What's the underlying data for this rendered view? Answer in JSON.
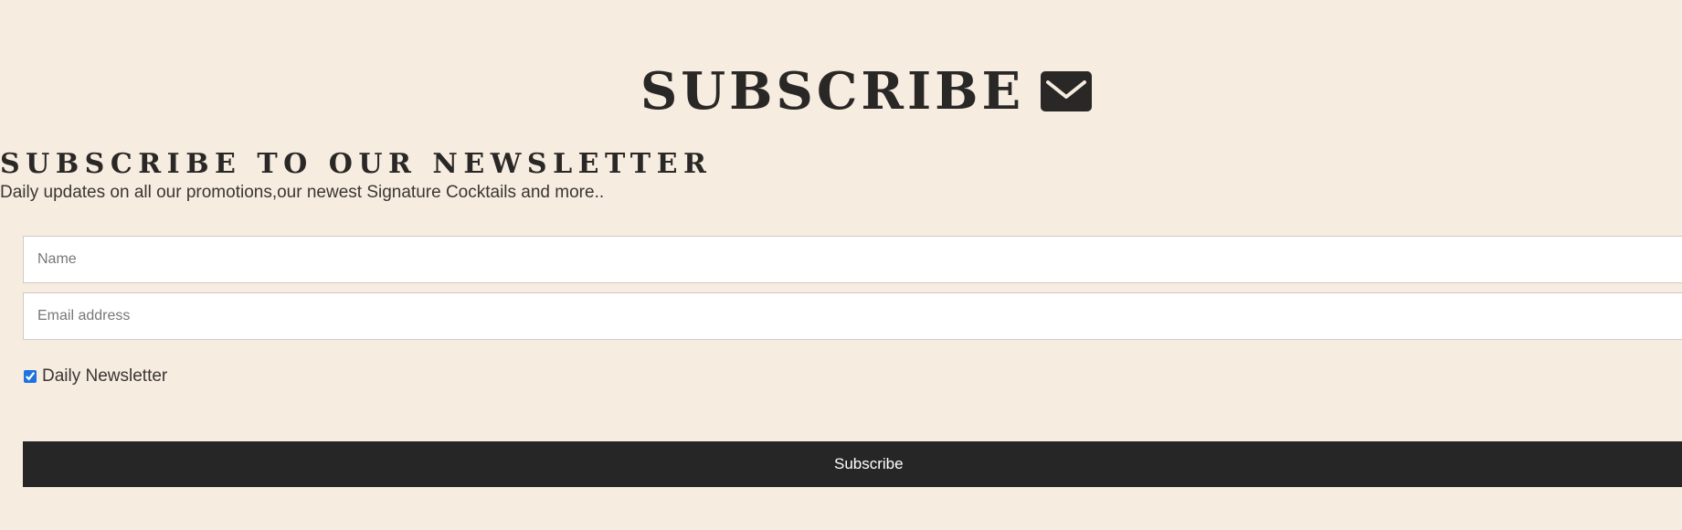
{
  "header": {
    "title": "SUBSCRIBE",
    "icon": "envelope-icon"
  },
  "newsletter": {
    "heading": "SUBSCRIBE TO OUR NEWSLETTER",
    "description": "Daily updates on all our promotions,our newest Signature Cocktails and more.."
  },
  "form": {
    "name_placeholder": "Name",
    "email_placeholder": "Email address",
    "checkbox_label": "Daily Newsletter",
    "checkbox_checked": true,
    "submit_label": "Subscribe"
  },
  "colors": {
    "background": "#f7ece0",
    "text": "#2a2826",
    "button": "#262626",
    "button_text": "#ffffff",
    "checkbox": "#1f73e0"
  }
}
